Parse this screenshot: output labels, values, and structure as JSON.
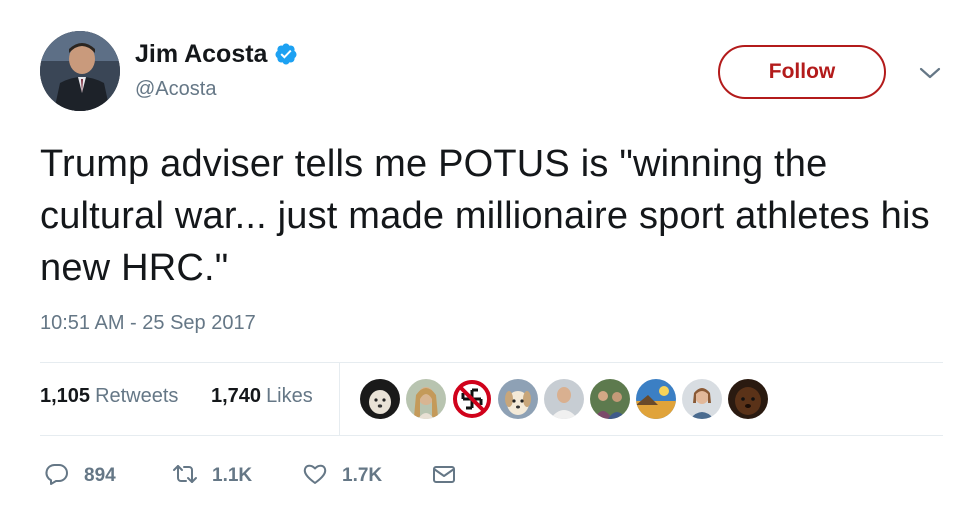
{
  "author": {
    "display_name": "Jim Acosta",
    "handle": "@Acosta",
    "verified": true
  },
  "follow_button": {
    "label": "Follow"
  },
  "tweet": {
    "text": "Trump adviser tells me POTUS is \"winning the cultural war... just made millionaire sport athletes his new HRC.\"",
    "timestamp": "10:51 AM - 25 Sep 2017"
  },
  "stats": {
    "retweets_count": "1,105",
    "retweets_label": "Retweets",
    "likes_count": "1,740",
    "likes_label": "Likes"
  },
  "liker_avatars": [
    "dog-avatar",
    "woman-avatar",
    "anti-swastika-avatar",
    "puppy-avatar",
    "person-avatar",
    "group-avatar",
    "landscape-avatar",
    "woman-avatar",
    "dog-avatar"
  ],
  "actions": {
    "reply_count": "894",
    "retweet_count": "1.1K",
    "like_count": "1.7K"
  },
  "colors": {
    "follow_accent": "#b31b1b",
    "verified_blue": "#1da1f2",
    "secondary_text": "#657786",
    "primary_text": "#14171a"
  }
}
